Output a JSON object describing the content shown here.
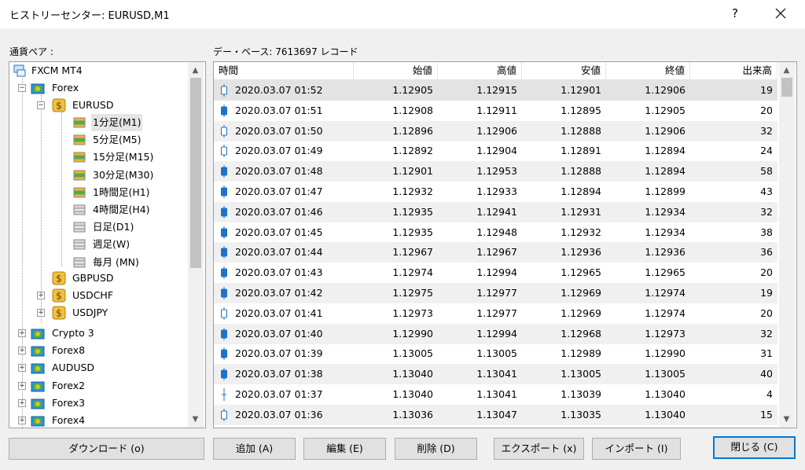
{
  "window": {
    "title": "ヒストリーセンター: EURUSD,M1",
    "help_label": "?"
  },
  "symbols_label": "通貨ペア :",
  "record_info": "デー・ベース: 7613697 レコード",
  "tree": {
    "root": "FXCM MT4",
    "forex": "Forex",
    "eurusd": "EURUSD",
    "timeframes": [
      "1分足(M1)",
      "5分足(M5)",
      "15分足(M15)",
      "30分足(M30)",
      "1時間足(H1)",
      "4時間足(H4)",
      "日足(D1)",
      "週足(W)",
      "毎月 (MN)"
    ],
    "pairs": [
      "GBPUSD",
      "USDCHF",
      "USDJPY"
    ],
    "groups": [
      "Crypto 3",
      "Forex8",
      "AUDUSD",
      "Forex2",
      "Forex3",
      "Forex4"
    ]
  },
  "table": {
    "columns": [
      "時間",
      "始値",
      "高値",
      "安値",
      "終値",
      "出来高"
    ],
    "rows": [
      [
        "2020.03.07 01:52",
        "1.12905",
        "1.12915",
        "1.12901",
        "1.12906",
        "19"
      ],
      [
        "2020.03.07 01:51",
        "1.12908",
        "1.12911",
        "1.12895",
        "1.12905",
        "20"
      ],
      [
        "2020.03.07 01:50",
        "1.12896",
        "1.12906",
        "1.12888",
        "1.12906",
        "32"
      ],
      [
        "2020.03.07 01:49",
        "1.12892",
        "1.12904",
        "1.12891",
        "1.12894",
        "24"
      ],
      [
        "2020.03.07 01:48",
        "1.12901",
        "1.12953",
        "1.12888",
        "1.12894",
        "58"
      ],
      [
        "2020.03.07 01:47",
        "1.12932",
        "1.12933",
        "1.12894",
        "1.12899",
        "43"
      ],
      [
        "2020.03.07 01:46",
        "1.12935",
        "1.12941",
        "1.12931",
        "1.12934",
        "32"
      ],
      [
        "2020.03.07 01:45",
        "1.12935",
        "1.12948",
        "1.12932",
        "1.12934",
        "38"
      ],
      [
        "2020.03.07 01:44",
        "1.12967",
        "1.12967",
        "1.12936",
        "1.12936",
        "36"
      ],
      [
        "2020.03.07 01:43",
        "1.12974",
        "1.12994",
        "1.12965",
        "1.12965",
        "20"
      ],
      [
        "2020.03.07 01:42",
        "1.12975",
        "1.12977",
        "1.12969",
        "1.12974",
        "19"
      ],
      [
        "2020.03.07 01:41",
        "1.12973",
        "1.12977",
        "1.12969",
        "1.12974",
        "20"
      ],
      [
        "2020.03.07 01:40",
        "1.12990",
        "1.12994",
        "1.12968",
        "1.12973",
        "32"
      ],
      [
        "2020.03.07 01:39",
        "1.13005",
        "1.13005",
        "1.12989",
        "1.12990",
        "31"
      ],
      [
        "2020.03.07 01:38",
        "1.13040",
        "1.13041",
        "1.13005",
        "1.13005",
        "40"
      ],
      [
        "2020.03.07 01:37",
        "1.13040",
        "1.13041",
        "1.13039",
        "1.13040",
        "4"
      ],
      [
        "2020.03.07 01:36",
        "1.13036",
        "1.13047",
        "1.13035",
        "1.13040",
        "15"
      ]
    ]
  },
  "buttons": {
    "download": "ダウンロード (o)",
    "add": "追加 (A)",
    "edit": "編集 (E)",
    "delete": "削除 (D)",
    "export": "エクスポート (x)",
    "import": "インポート (I)",
    "close": "閉じる (C)"
  },
  "colors": {
    "bull": "#1e73c8",
    "bear_outline": "#1e73c8",
    "gold": "#e8b830",
    "green": "#3cb83c",
    "blue": "#2f8fe0"
  }
}
